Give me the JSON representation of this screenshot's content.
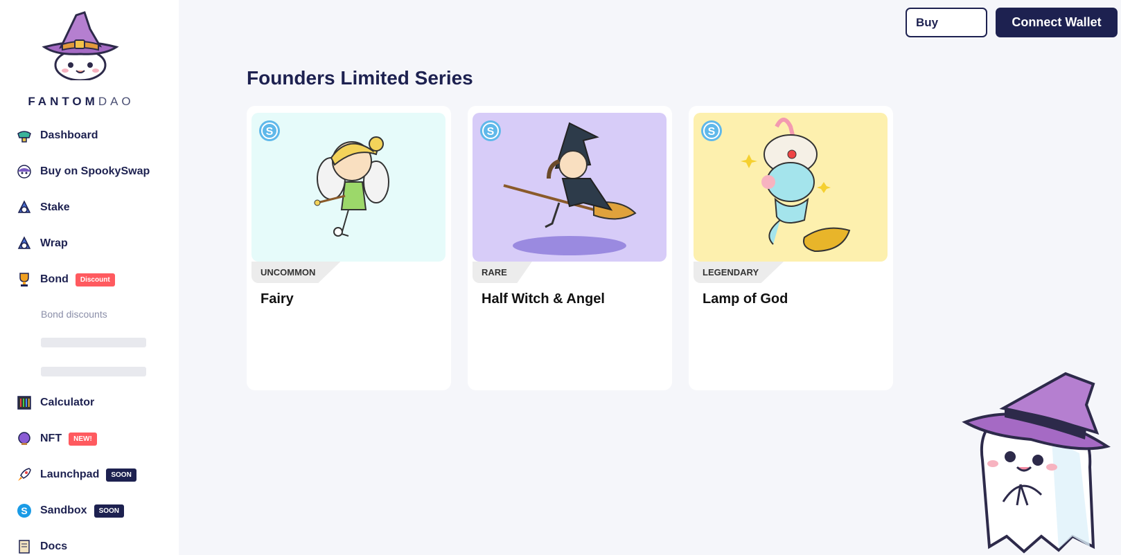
{
  "brand": {
    "name_bold": "FANTOM",
    "name_light": "DAO"
  },
  "sidebar": {
    "items": [
      {
        "label": "Dashboard",
        "icon": "dashboard-icon"
      },
      {
        "label": "Buy on SpookySwap",
        "icon": "spookyswap-icon"
      },
      {
        "label": "Stake",
        "icon": "stake-icon"
      },
      {
        "label": "Wrap",
        "icon": "wrap-icon"
      },
      {
        "label": "Bond",
        "icon": "trophy-icon",
        "badge": "Discount"
      },
      {
        "label": "Calculator",
        "icon": "calculator-icon"
      },
      {
        "label": "NFT",
        "icon": "nft-icon",
        "badge": "NEW!"
      },
      {
        "label": "Launchpad",
        "icon": "rocket-icon",
        "badge": "SOON"
      },
      {
        "label": "Sandbox",
        "icon": "sandbox-icon",
        "badge": "SOON"
      },
      {
        "label": "Docs",
        "icon": "docs-icon"
      }
    ],
    "bond_sub_label": "Bond discounts"
  },
  "header": {
    "buy_label": "Buy",
    "connect_label": "Connect Wallet"
  },
  "main": {
    "title": "Founders Limited Series",
    "cards": [
      {
        "rarity": "UNCOMMON",
        "name": "Fairy",
        "bg": "#e6fbfa"
      },
      {
        "rarity": "RARE",
        "name": "Half Witch & Angel",
        "bg": "#d7ccf8"
      },
      {
        "rarity": "LEGENDARY",
        "name": "Lamp of God",
        "bg": "#fdf0ae"
      }
    ]
  },
  "colors": {
    "navy": "#1d2150",
    "badge_red": "#ff5a5f",
    "sandbox_blue": "#5fb8ea"
  }
}
